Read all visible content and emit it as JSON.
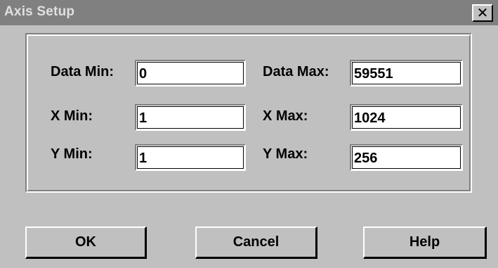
{
  "window": {
    "title": "Axis Setup",
    "close_glyph": "✕"
  },
  "fields": {
    "data_min": {
      "label": "Data Min:",
      "value": "0"
    },
    "data_max": {
      "label": "Data Max:",
      "value": "59551"
    },
    "x_min": {
      "label": "X Min:",
      "value": "1"
    },
    "x_max": {
      "label": "X Max:",
      "value": "1024"
    },
    "y_min": {
      "label": "Y Min:",
      "value": "1"
    },
    "y_max": {
      "label": "Y Max:",
      "value": "256"
    }
  },
  "buttons": {
    "ok": "OK",
    "cancel": "Cancel",
    "help": "Help"
  },
  "colors": {
    "face": "#c0c0c0",
    "titlebar_inactive": "#808080",
    "title_text": "#e0e0e0",
    "field_bg": "#ffffff"
  }
}
